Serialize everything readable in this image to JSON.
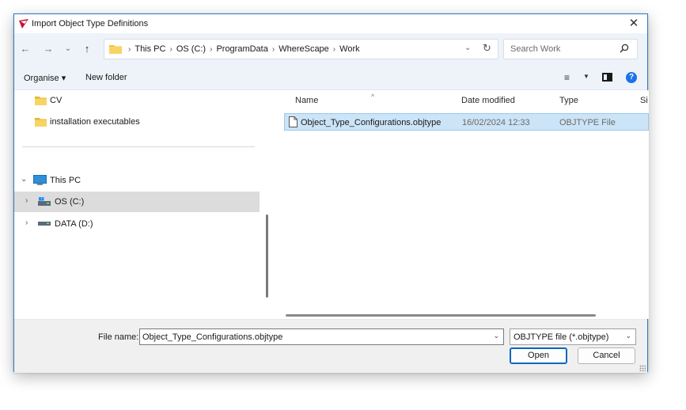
{
  "window": {
    "title": "Import Object Type Definitions",
    "close": "✕"
  },
  "nav": {
    "back": "←",
    "forward": "→",
    "recent": "⌄",
    "up": "↑",
    "breadcrumb": [
      "This PC",
      "OS (C:)",
      "ProgramData",
      "WhereScape",
      "Work"
    ],
    "separator": "›",
    "dropdown": "⌄",
    "refresh": "↻",
    "search_placeholder": "Search Work"
  },
  "toolbar": {
    "organise": "Organise ▾",
    "new_folder": "New folder",
    "views": "≡",
    "views_dd": "▼",
    "help": "?"
  },
  "sidebar": {
    "items": [
      {
        "label": "CV",
        "icon": "folder-icon"
      },
      {
        "label": "installation executables",
        "icon": "folder-icon"
      },
      {
        "label": "This PC",
        "icon": "computer-icon",
        "expanded": true
      },
      {
        "label": "OS (C:)",
        "icon": "drive-icon",
        "selected": true
      },
      {
        "label": "DATA (D:)",
        "icon": "drive-icon"
      }
    ],
    "expanded_chevron": "⌄",
    "collapsed_chevron": "›"
  },
  "files": {
    "sort_indicator": "^",
    "columns": [
      "Name",
      "Date modified",
      "Type",
      "Si"
    ],
    "rows": [
      {
        "name": "Object_Type_Configurations.objtype",
        "date": "16/02/2024 12:33",
        "type": "OBJTYPE File",
        "selected": true
      }
    ]
  },
  "footer": {
    "file_name_label": "File name:",
    "file_name_value": "Object_Type_Configurations.objtype",
    "dropdown": "⌄",
    "filter": "OBJTYPE file (*.objtype)",
    "open": "Open",
    "cancel": "Cancel"
  },
  "colors": {
    "accent": "#0067c0",
    "selection": "#cce4f7",
    "nav_bg": "#eef3f9",
    "folder": "#f3c340"
  }
}
